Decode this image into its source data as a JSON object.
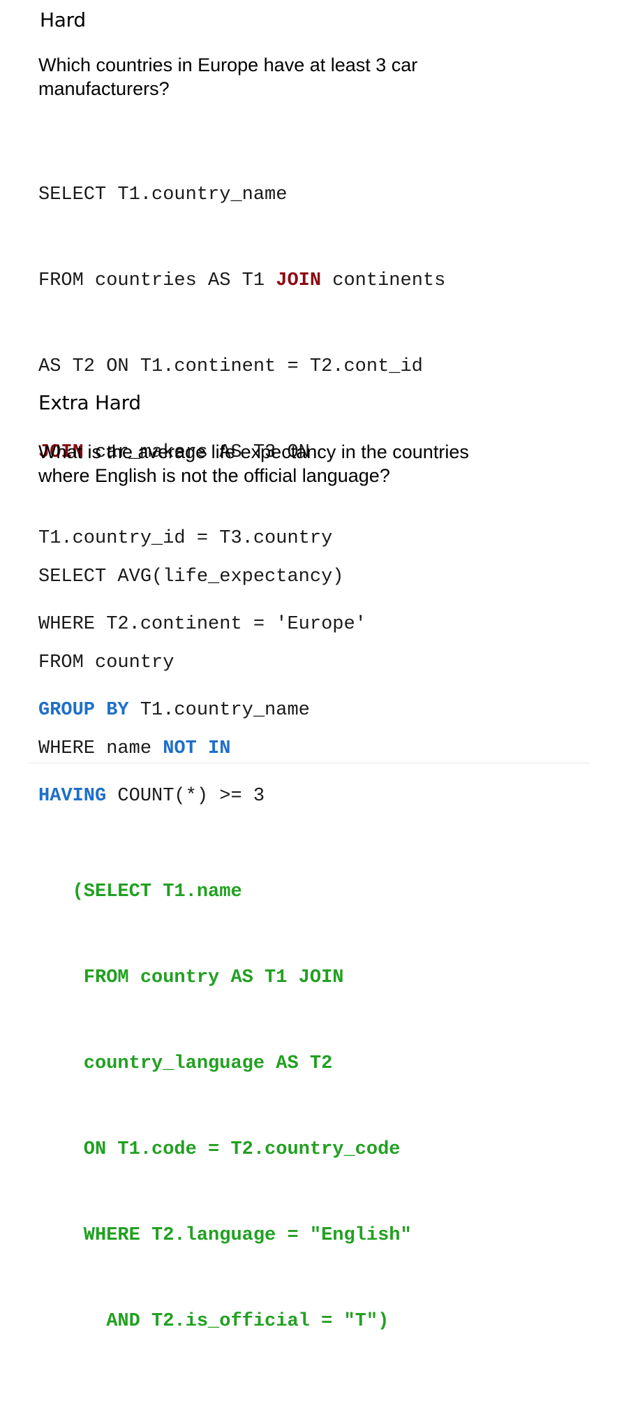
{
  "sections": [
    {
      "heading": "Hard",
      "question_lines": [
        "Which countries in Europe have at least 3 car",
        "manufacturers?"
      ],
      "code": {
        "l1": "SELECT T1.country_name",
        "l2a": "FROM countries AS T1 ",
        "l2kw": "JOIN",
        "l2b": " continents",
        "l3": "AS T2 ON T1.continent = T2.cont_id",
        "l4kw": "JOIN",
        "l4b": " car_makers AS T3 ON",
        "l5": "T1.country_id = T3.country",
        "l6": "WHERE T2.continent = 'Europe'",
        "l7kw": "GROUP BY",
        "l7b": " T1.country_name",
        "l8kw": "HAVING",
        "l8b": " COUNT(*) >= 3"
      }
    },
    {
      "heading": "Extra Hard",
      "question_lines": [
        "What is the average life expectancy in the countries",
        "where English is not the official language?"
      ],
      "code": {
        "l1": "SELECT AVG(life_expectancy)",
        "l2": "FROM country",
        "l3a": "WHERE name ",
        "l3kw": "NOT IN",
        "sub1": "   (SELECT T1.name",
        "sub2": "    FROM country AS T1 JOIN",
        "sub3": "    country_language AS T2",
        "sub4": "    ON T1.code = T2.country_code",
        "sub5": "    WHERE T2.language = \"English\"",
        "sub6": "      AND T2.is_official = \"T\")"
      }
    }
  ],
  "colors": {
    "keyword_red": "#8b0b12",
    "keyword_blue": "#1f6fc9",
    "subquery_green": "#22a022"
  }
}
